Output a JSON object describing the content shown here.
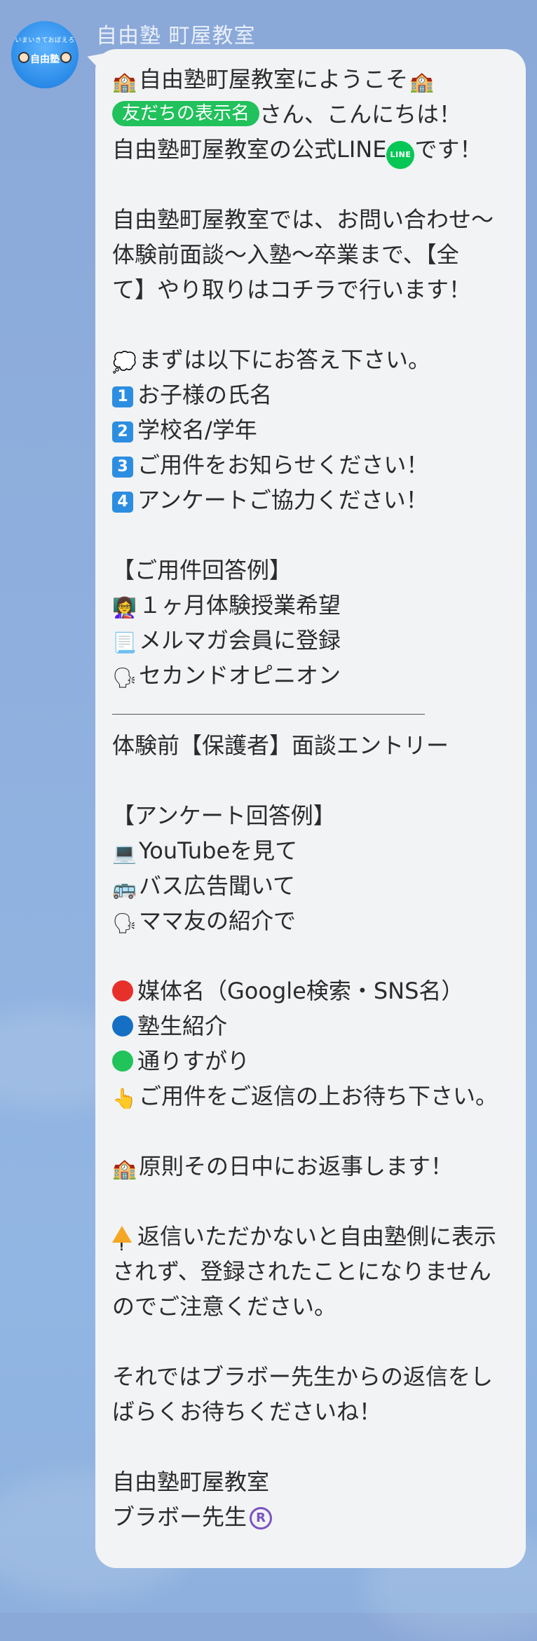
{
  "sender": {
    "name": "自由塾 町屋教室"
  },
  "avatar": {
    "top_text": "いまいきておぼえろ",
    "label": "自由塾"
  },
  "message": {
    "lines": [
      {
        "type": "text",
        "icon": "house-icon",
        "glyph": "🏫",
        "text": "自由塾町屋教室にようこそ",
        "icon2": "house-icon",
        "glyph2": "🏫"
      },
      {
        "type": "chip",
        "chip": "友だちの表示名",
        "text": "さん、こんにちは！"
      },
      {
        "type": "line_badge",
        "text": "自由塾町屋教室の公式LINE",
        "badge": "LINE",
        "after": "です！"
      },
      {
        "type": "blank"
      },
      {
        "type": "text",
        "text": "自由塾町屋教室では、お問い合わせ〜"
      },
      {
        "type": "text",
        "text": "体験前面談〜入塾〜卒業まで、【全"
      },
      {
        "type": "text",
        "text": "て】やり取りはコチラで行います！"
      },
      {
        "type": "blank"
      },
      {
        "type": "text",
        "icon": "speech-bubble-icon",
        "glyph": "💭",
        "text": "まずは以下にお答え下さい。"
      },
      {
        "type": "num",
        "num": "1",
        "text": "お子様の氏名"
      },
      {
        "type": "num",
        "num": "2",
        "text": "学校名/学年"
      },
      {
        "type": "num",
        "num": "3",
        "text": "ご用件をお知らせください！"
      },
      {
        "type": "num",
        "num": "4",
        "text": "アンケートご協力ください！"
      },
      {
        "type": "blank"
      },
      {
        "type": "text",
        "text": "【ご用件回答例】"
      },
      {
        "type": "text",
        "icon": "teacher-icon",
        "glyph": "👩‍🏫",
        "text": "１ヶ月体験授業希望"
      },
      {
        "type": "text",
        "icon": "document-icon",
        "glyph": "📃",
        "text": "メルマガ会員に登録"
      },
      {
        "type": "text",
        "icon": "speaking-head-icon",
        "glyph": "🗣",
        "text": "セカンドオピニオン"
      },
      {
        "type": "rule"
      },
      {
        "type": "text",
        "text": "体験前【保護者】面談エントリー"
      },
      {
        "type": "blank"
      },
      {
        "type": "text",
        "text": "【アンケート回答例】"
      },
      {
        "type": "text",
        "icon": "laptop-icon",
        "glyph": "💻",
        "text": "YouTubeを見て"
      },
      {
        "type": "text",
        "icon": "bus-icon",
        "glyph": "🚌",
        "text": "バス広告聞いて"
      },
      {
        "type": "text",
        "icon": "speaking-head-icon",
        "glyph": "🗣",
        "text": "ママ友の紹介で"
      },
      {
        "type": "blank"
      },
      {
        "type": "dot",
        "color": "#e8302a",
        "icon": "red-circle-icon",
        "text": "媒体名（Google検索・SNS名）"
      },
      {
        "type": "dot",
        "color": "#1570c4",
        "icon": "blue-circle-icon",
        "text": "塾生紹介"
      },
      {
        "type": "dot",
        "color": "#20c45a",
        "icon": "green-circle-icon",
        "text": "通りすがり"
      },
      {
        "type": "text",
        "icon": "pointing-hand-icon",
        "glyph": "👆",
        "text": "ご用件をご返信の上お待ち下さい。"
      },
      {
        "type": "blank"
      },
      {
        "type": "text",
        "icon": "house-icon",
        "glyph": "🏫",
        "text": "原則その日中にお返事します！"
      },
      {
        "type": "blank"
      },
      {
        "type": "warn",
        "icon": "warning-icon",
        "text": "返信いただかないと自由塾側に表示"
      },
      {
        "type": "text",
        "text": "されず、登録されたことになりません"
      },
      {
        "type": "text",
        "text": "のでご注意ください。"
      },
      {
        "type": "blank"
      },
      {
        "type": "text",
        "text": "それではブラボー先生からの返信をし"
      },
      {
        "type": "text",
        "text": "ばらくお待ちくださいね！"
      },
      {
        "type": "blank"
      },
      {
        "type": "text",
        "text": "自由塾町屋教室"
      },
      {
        "type": "reg",
        "text": "ブラボー先生",
        "mark": "R"
      }
    ]
  }
}
